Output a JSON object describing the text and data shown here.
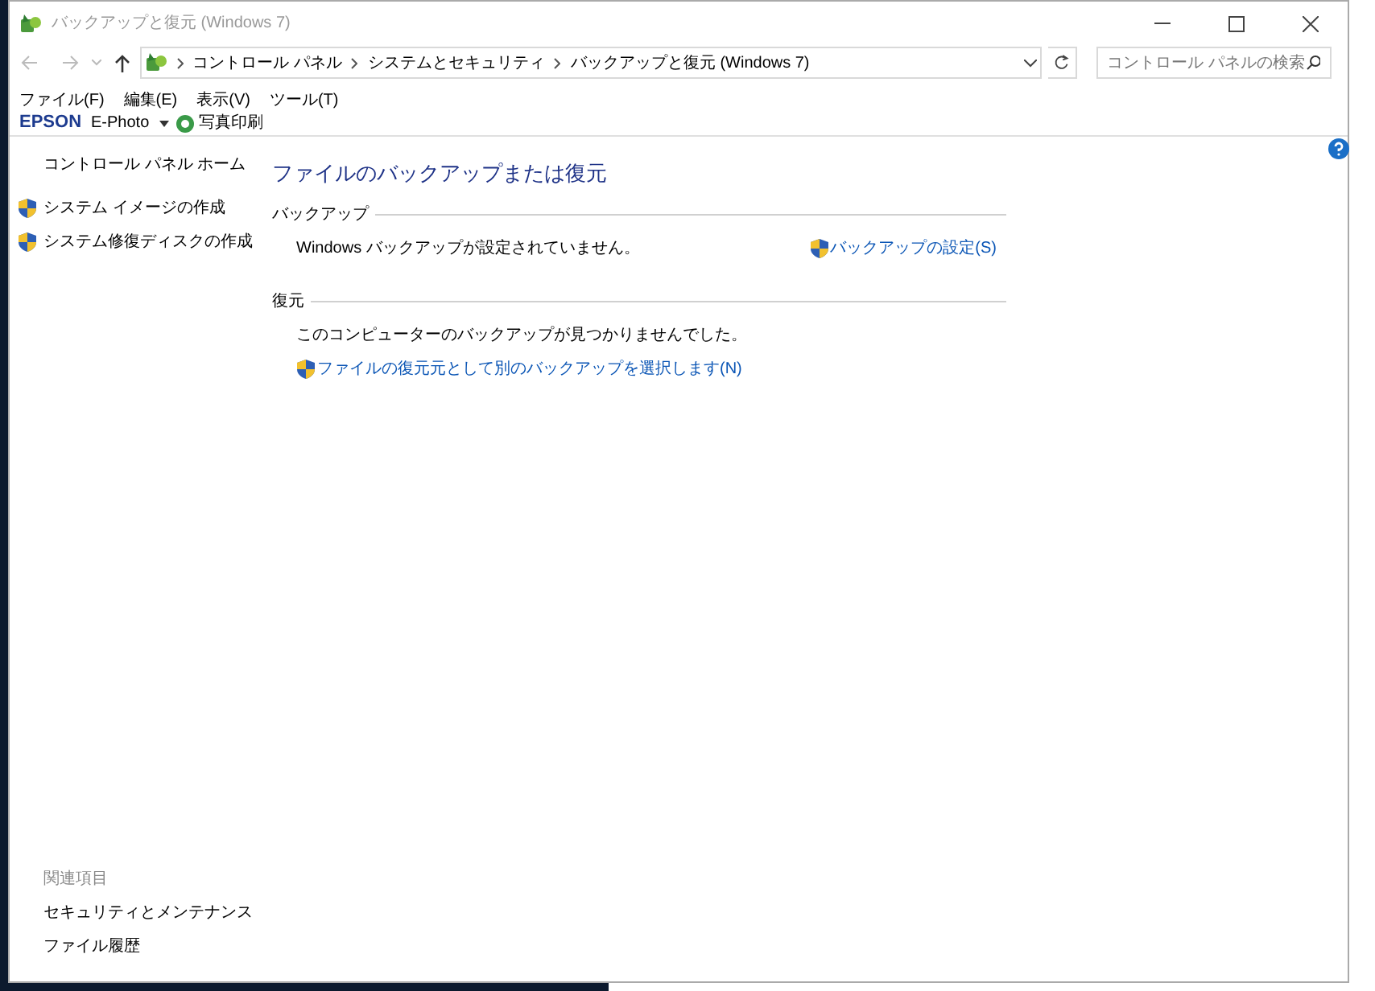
{
  "window": {
    "title": "バックアップと復元 (Windows 7)"
  },
  "address_bar": {
    "path": [
      "コントロール パネル",
      "システムとセキュリティ",
      "バックアップと復元 (Windows 7)"
    ]
  },
  "search": {
    "placeholder": "コントロール パネルの検索"
  },
  "menu": [
    "ファイル(F)",
    "編集(E)",
    "表示(V)",
    "ツール(T)"
  ],
  "epson_toolbar": {
    "brand": "EPSON",
    "app": "E-Photo",
    "print": "写真印刷"
  },
  "sidebar": {
    "home": "コントロール パネル ホーム",
    "items": [
      {
        "label": "システム イメージの作成"
      },
      {
        "label": "システム修復ディスクの作成"
      }
    ],
    "related_title": "関連項目",
    "related": [
      "セキュリティとメンテナンス",
      "ファイル履歴"
    ]
  },
  "main": {
    "title": "ファイルのバックアップまたは復元",
    "sections": [
      {
        "heading": "バックアップ",
        "message": "Windows バックアップが設定されていません。",
        "link": "バックアップの設定(S)",
        "kind": "side"
      },
      {
        "heading": "復元",
        "message": "このコンピューターのバックアップが見つかりませんでした。",
        "link": "ファイルの復元元として別のバックアップを選択します(N)",
        "kind": "below"
      }
    ]
  }
}
